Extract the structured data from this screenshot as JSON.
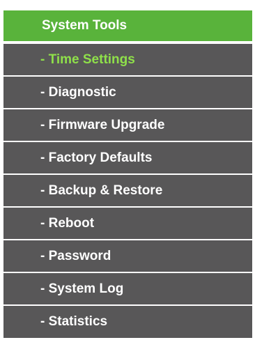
{
  "menu": {
    "header_label": "System Tools",
    "items": [
      {
        "label": "- Time Settings"
      },
      {
        "label": "- Diagnostic"
      },
      {
        "label": "- Firmware Upgrade"
      },
      {
        "label": "- Factory Defaults"
      },
      {
        "label": "- Backup & Restore"
      },
      {
        "label": "- Reboot"
      },
      {
        "label": "- Password"
      },
      {
        "label": "- System Log"
      },
      {
        "label": "- Statistics"
      }
    ],
    "active_item": "- Time Settings"
  },
  "colors": {
    "header_background": "#59b33b",
    "item_background": "#585758",
    "item_text": "#ffffff",
    "active_item_text": "#8fe04a"
  }
}
